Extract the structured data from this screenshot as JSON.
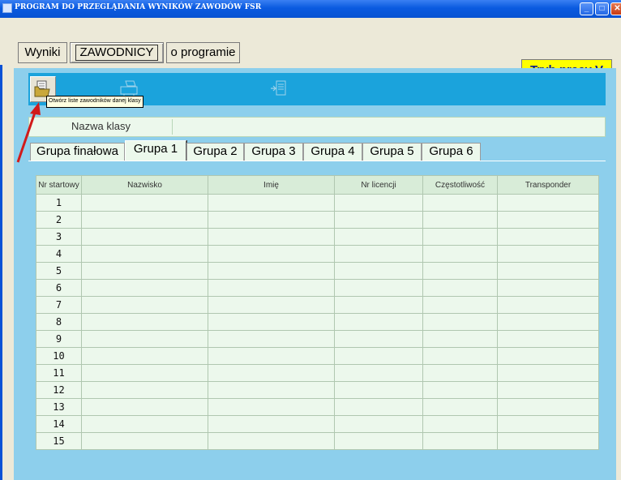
{
  "window": {
    "title": "PROGRAM DO PRZEGLĄDANIA WYNIKÓW ZAWODÓW FSR"
  },
  "menu": {
    "wyniki": "Wyniki",
    "zawodnicy": "ZAWODNICY",
    "o_programie": "o programie"
  },
  "mode": {
    "label": "Tryb pracy V"
  },
  "toolbar": {
    "tooltip": "Otwórz liste zawodników danej klasy"
  },
  "class": {
    "label": "Nazwa klasy",
    "value": ""
  },
  "tabs": [
    "Grupa finałowa",
    "Grupa 1",
    "Grupa 2",
    "Grupa 3",
    "Grupa 4",
    "Grupa 5",
    "Grupa 6"
  ],
  "selected_tab": "Grupa 1",
  "table": {
    "columns": [
      "Nr startowy",
      "Nazwisko",
      "Imię",
      "Nr licencji",
      "Częstotliwość",
      "Transponder"
    ],
    "rows": [
      "1",
      "2",
      "3",
      "4",
      "5",
      "6",
      "7",
      "8",
      "9",
      "10",
      "11",
      "12",
      "13",
      "14",
      "15"
    ]
  },
  "colors": {
    "accent": "#1ba3dc",
    "panel": "#8dcfec",
    "mode_bg": "#ffff00",
    "arrow": "#d11a1a"
  }
}
